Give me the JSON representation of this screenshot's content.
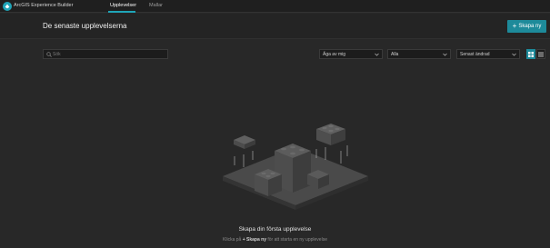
{
  "app": {
    "title": "ArcGIS Experience Builder"
  },
  "nav": {
    "tabs": [
      {
        "label": "Upplevelser",
        "active": true
      },
      {
        "label": "Mallar",
        "active": false
      }
    ]
  },
  "header": {
    "title": "De senaste upplevelserna",
    "create_label": "Skapa ny"
  },
  "toolbar": {
    "search_placeholder": "Sök",
    "owner_filter": "Äga av mig",
    "type_filter": "Alla",
    "sort": "Senast ändrad",
    "view_mode": "grid"
  },
  "empty_state": {
    "title": "Skapa din första upplevelse",
    "subtitle_before": "Klicka på",
    "subtitle_action": "+ Skapa ny",
    "subtitle_after": "för att starta en ny upplevelse"
  },
  "colors": {
    "accent": "#1fa5b8",
    "button": "#1d8a9a",
    "background": "#282828"
  },
  "icons": [
    "experience-builder-logo-icon",
    "plus-icon",
    "search-icon",
    "chevron-down-icon",
    "grid-view-icon",
    "list-view-icon",
    "blocks-illustration"
  ]
}
